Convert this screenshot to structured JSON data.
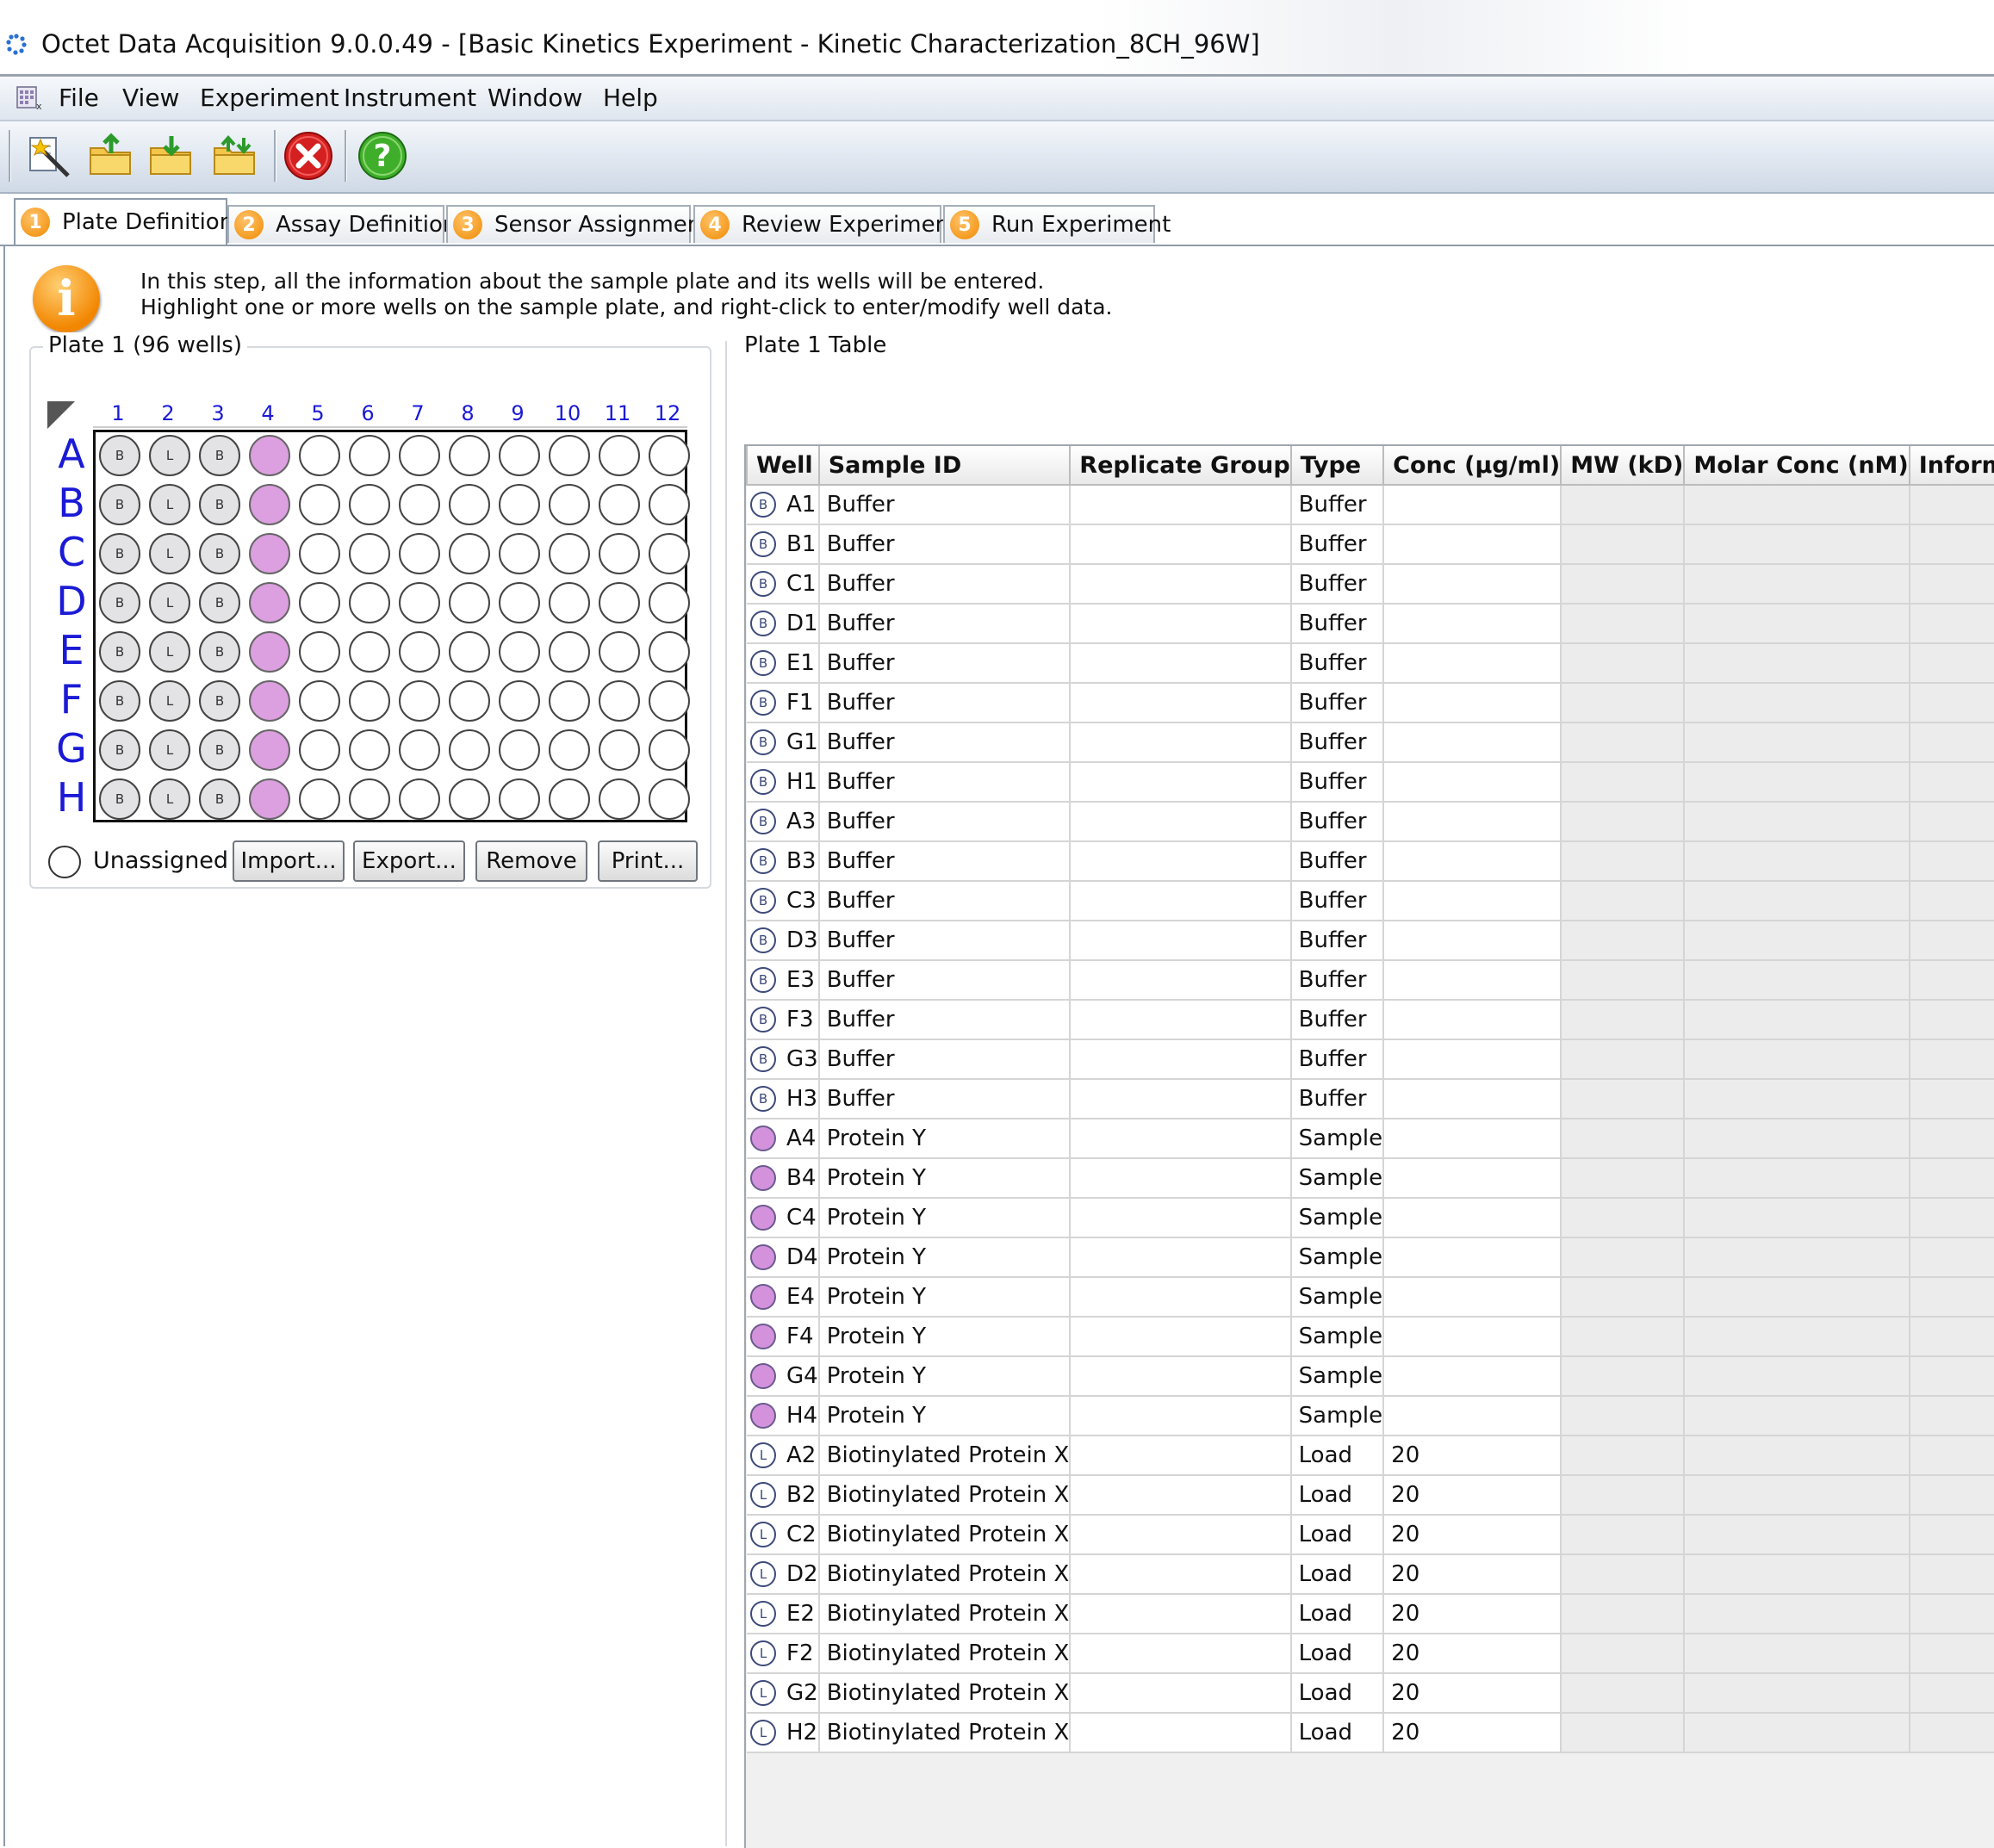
{
  "window": {
    "title": "Octet Data Acquisition 9.0.0.49 - [Basic Kinetics Experiment - Kinetic Characterization_8CH_96W]"
  },
  "menu": {
    "items": [
      "File",
      "View",
      "Experiment",
      "Instrument",
      "Window",
      "Help"
    ]
  },
  "toolbar": {
    "icons": [
      "wizard-icon",
      "open-folder-icon",
      "save-folder-icon",
      "export-folder-icon",
      "stop-icon",
      "help-icon"
    ]
  },
  "tabs": [
    {
      "num": "1",
      "label": "Plate Definition",
      "active": true
    },
    {
      "num": "2",
      "label": "Assay Definition"
    },
    {
      "num": "3",
      "label": "Sensor Assignment"
    },
    {
      "num": "4",
      "label": "Review Experiment"
    },
    {
      "num": "5",
      "label": "Run Experiment"
    }
  ],
  "info": {
    "line1": "In this step, all the information about the sample plate and its wells will be entered.",
    "line2": "Highlight one or more wells on the sample plate, and right-click to enter/modify well data."
  },
  "plate": {
    "title": "Plate 1 (96 wells)",
    "columns": [
      "1",
      "2",
      "3",
      "4",
      "5",
      "6",
      "7",
      "8",
      "9",
      "10",
      "11",
      "12"
    ],
    "rows": [
      "A",
      "B",
      "C",
      "D",
      "E",
      "F",
      "G",
      "H"
    ],
    "column_types": [
      "B",
      "L",
      "B",
      "S",
      "",
      "",
      "",
      "",
      "",
      "",
      "",
      ""
    ],
    "unassigned_label": "Unassigned",
    "buttons": {
      "import": "Import...",
      "export": "Export...",
      "remove": "Remove",
      "print": "Print..."
    },
    "colors": {
      "sample": "#dc9fe0",
      "buffer_load": "#e3e3e6"
    }
  },
  "table": {
    "title": "Plate 1 Table",
    "headers": [
      "Well",
      "Sample ID",
      "Replicate Group",
      "Type",
      "Conc (µg/ml)",
      "MW (kD)",
      "Molar Conc (nM)",
      "Information"
    ],
    "rows": [
      {
        "icon": "B",
        "well": "A1",
        "sample_id": "Buffer",
        "type": "Buffer",
        "conc": ""
      },
      {
        "icon": "B",
        "well": "B1",
        "sample_id": "Buffer",
        "type": "Buffer",
        "conc": ""
      },
      {
        "icon": "B",
        "well": "C1",
        "sample_id": "Buffer",
        "type": "Buffer",
        "conc": ""
      },
      {
        "icon": "B",
        "well": "D1",
        "sample_id": "Buffer",
        "type": "Buffer",
        "conc": ""
      },
      {
        "icon": "B",
        "well": "E1",
        "sample_id": "Buffer",
        "type": "Buffer",
        "conc": ""
      },
      {
        "icon": "B",
        "well": "F1",
        "sample_id": "Buffer",
        "type": "Buffer",
        "conc": ""
      },
      {
        "icon": "B",
        "well": "G1",
        "sample_id": "Buffer",
        "type": "Buffer",
        "conc": ""
      },
      {
        "icon": "B",
        "well": "H1",
        "sample_id": "Buffer",
        "type": "Buffer",
        "conc": ""
      },
      {
        "icon": "B",
        "well": "A3",
        "sample_id": "Buffer",
        "type": "Buffer",
        "conc": ""
      },
      {
        "icon": "B",
        "well": "B3",
        "sample_id": "Buffer",
        "type": "Buffer",
        "conc": ""
      },
      {
        "icon": "B",
        "well": "C3",
        "sample_id": "Buffer",
        "type": "Buffer",
        "conc": ""
      },
      {
        "icon": "B",
        "well": "D3",
        "sample_id": "Buffer",
        "type": "Buffer",
        "conc": ""
      },
      {
        "icon": "B",
        "well": "E3",
        "sample_id": "Buffer",
        "type": "Buffer",
        "conc": ""
      },
      {
        "icon": "B",
        "well": "F3",
        "sample_id": "Buffer",
        "type": "Buffer",
        "conc": ""
      },
      {
        "icon": "B",
        "well": "G3",
        "sample_id": "Buffer",
        "type": "Buffer",
        "conc": ""
      },
      {
        "icon": "B",
        "well": "H3",
        "sample_id": "Buffer",
        "type": "Buffer",
        "conc": ""
      },
      {
        "icon": "S",
        "well": "A4",
        "sample_id": "Protein Y",
        "type": "Sample",
        "conc": ""
      },
      {
        "icon": "S",
        "well": "B4",
        "sample_id": "Protein Y",
        "type": "Sample",
        "conc": ""
      },
      {
        "icon": "S",
        "well": "C4",
        "sample_id": "Protein Y",
        "type": "Sample",
        "conc": ""
      },
      {
        "icon": "S",
        "well": "D4",
        "sample_id": "Protein Y",
        "type": "Sample",
        "conc": ""
      },
      {
        "icon": "S",
        "well": "E4",
        "sample_id": "Protein Y",
        "type": "Sample",
        "conc": ""
      },
      {
        "icon": "S",
        "well": "F4",
        "sample_id": "Protein Y",
        "type": "Sample",
        "conc": ""
      },
      {
        "icon": "S",
        "well": "G4",
        "sample_id": "Protein Y",
        "type": "Sample",
        "conc": ""
      },
      {
        "icon": "S",
        "well": "H4",
        "sample_id": "Protein Y",
        "type": "Sample",
        "conc": ""
      },
      {
        "icon": "L",
        "well": "A2",
        "sample_id": "Biotinylated Protein X",
        "type": "Load",
        "conc": "20"
      },
      {
        "icon": "L",
        "well": "B2",
        "sample_id": "Biotinylated Protein X",
        "type": "Load",
        "conc": "20"
      },
      {
        "icon": "L",
        "well": "C2",
        "sample_id": "Biotinylated Protein X",
        "type": "Load",
        "conc": "20"
      },
      {
        "icon": "L",
        "well": "D2",
        "sample_id": "Biotinylated Protein X",
        "type": "Load",
        "conc": "20"
      },
      {
        "icon": "L",
        "well": "E2",
        "sample_id": "Biotinylated Protein X",
        "type": "Load",
        "conc": "20"
      },
      {
        "icon": "L",
        "well": "F2",
        "sample_id": "Biotinylated Protein X",
        "type": "Load",
        "conc": "20"
      },
      {
        "icon": "L",
        "well": "G2",
        "sample_id": "Biotinylated Protein X",
        "type": "Load",
        "conc": "20"
      },
      {
        "icon": "L",
        "well": "H2",
        "sample_id": "Biotinylated Protein X",
        "type": "Load",
        "conc": "20"
      }
    ]
  }
}
